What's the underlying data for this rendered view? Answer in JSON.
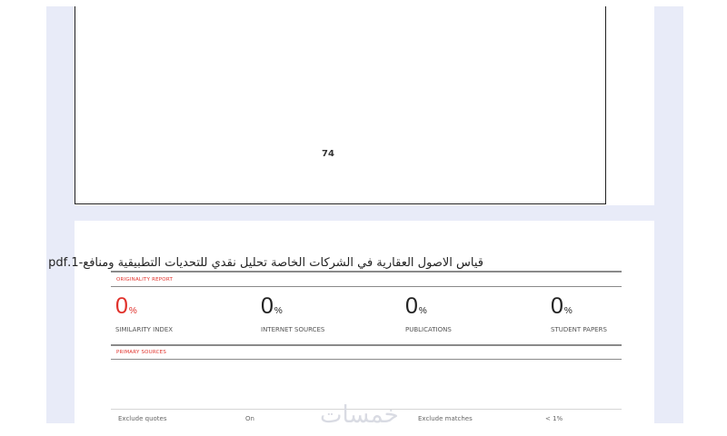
{
  "previous_page": {
    "page_number": "74"
  },
  "report": {
    "title": "قياس الاصول العقارية في الشركات الخاصة تحليل نقدي للتحديات التطبيقية ومنافع-1.pdf",
    "originality_label": "ORIGINALITY REPORT",
    "primary_sources_label": "PRIMARY SOURCES",
    "accent_color": "#e0302a",
    "stats": [
      {
        "value": "0",
        "unit": "%",
        "label": "SIMILARITY INDEX"
      },
      {
        "value": "0",
        "unit": "%",
        "label": "INTERNET SOURCES"
      },
      {
        "value": "0",
        "unit": "%",
        "label": "PUBLICATIONS"
      },
      {
        "value": "0",
        "unit": "%",
        "label": "STUDENT PAPERS"
      }
    ],
    "footer": {
      "exclude_quotes_label": "Exclude quotes",
      "exclude_quotes_value": "On",
      "exclude_matches_label": "Exclude matches",
      "exclude_matches_value": "< 1%"
    }
  },
  "watermark": {
    "text": "خمسات"
  }
}
